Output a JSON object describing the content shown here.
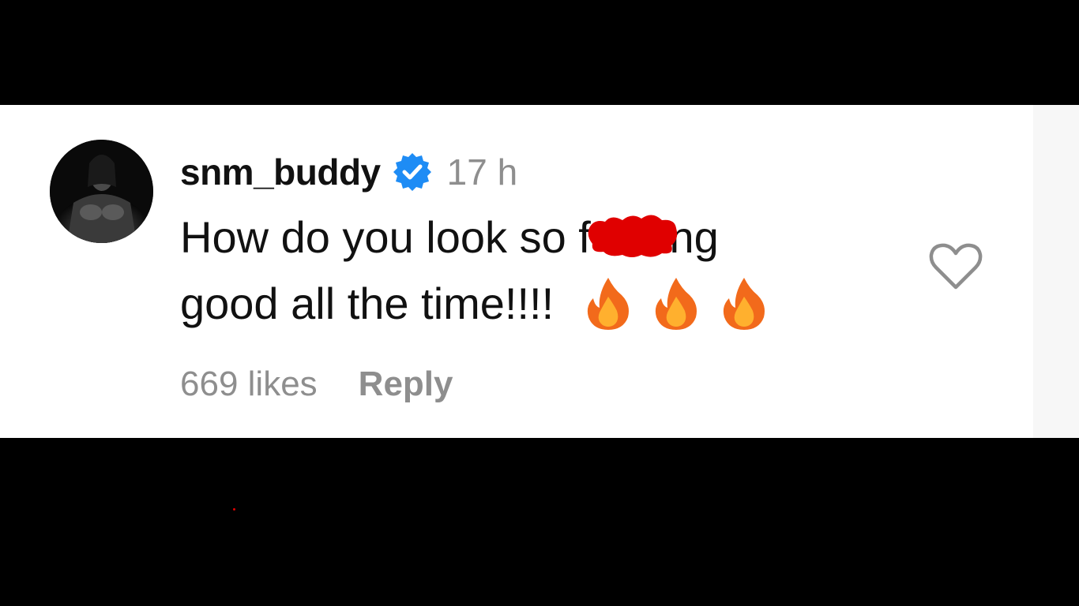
{
  "comment": {
    "username": "snm_buddy",
    "verified_icon": "verified-badge-icon",
    "timestamp": "17 h",
    "text_line1_before": "How do you look so f",
    "text_line1_after": "ing",
    "text_line2": "good all the time!!!!",
    "emojis": [
      "fire-icon",
      "fire-icon",
      "fire-icon"
    ],
    "likes": "669 likes",
    "reply_label": "Reply",
    "like_icon": "heart-outline-icon",
    "censor_icon": "red-censor-scribble-icon"
  },
  "colors": {
    "background": "#ffffff",
    "letterbox": "#000000",
    "text_primary": "#111111",
    "text_secondary": "#8e8e8e",
    "verified": "#1e8cf5",
    "censor": "#e00000"
  }
}
